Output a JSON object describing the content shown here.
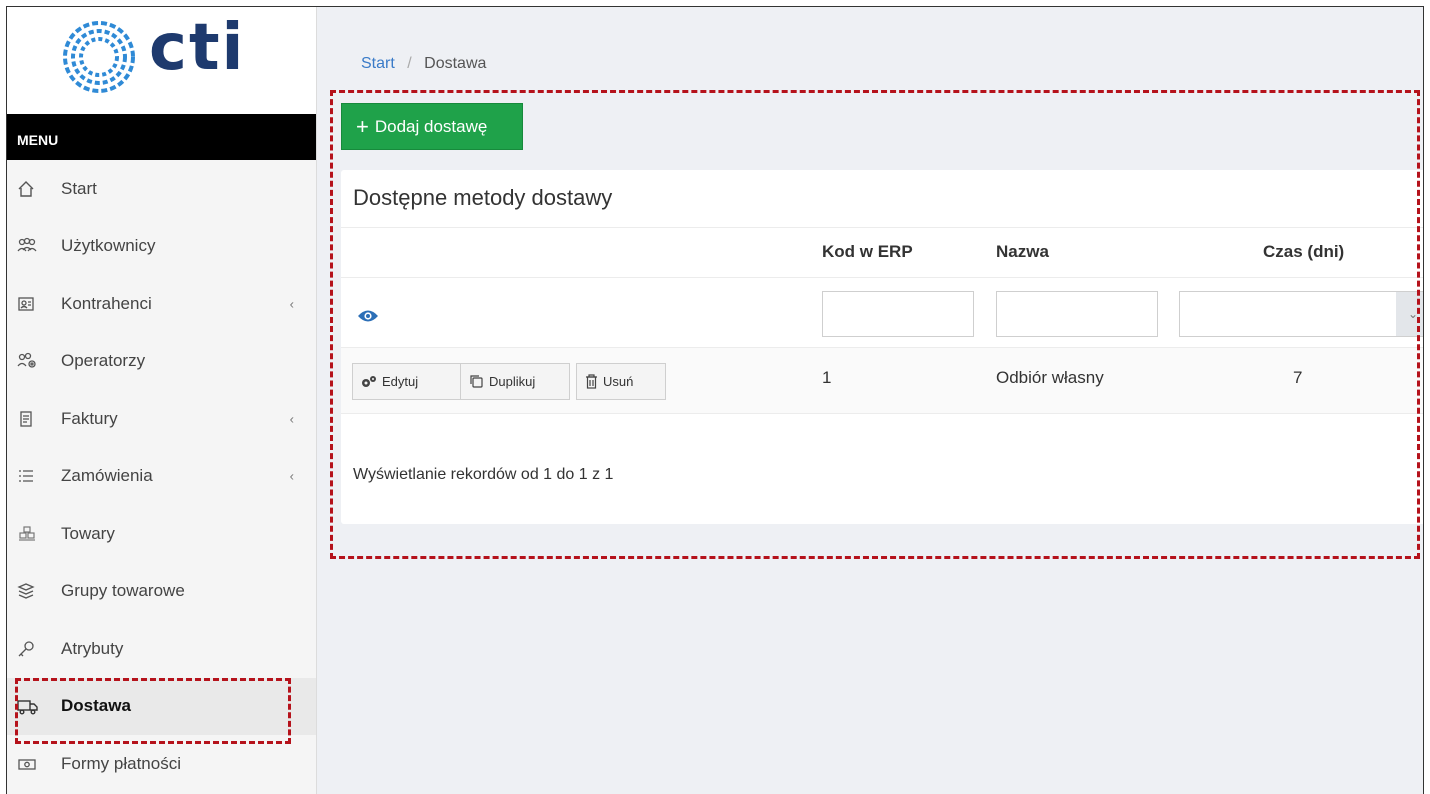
{
  "brand": {
    "logo_text": "cti"
  },
  "sidebar": {
    "menu_label": "MENU",
    "items": [
      {
        "label": "Start",
        "icon": "home-icon"
      },
      {
        "label": "Użytkownicy",
        "icon": "users-icon"
      },
      {
        "label": "Kontrahenci",
        "icon": "contact-card-icon",
        "chevron": "‹"
      },
      {
        "label": "Operatorzy",
        "icon": "operators-icon"
      },
      {
        "label": "Faktury",
        "icon": "invoice-icon",
        "chevron": "‹"
      },
      {
        "label": "Zamówienia",
        "icon": "list-icon",
        "chevron": "‹"
      },
      {
        "label": "Towary",
        "icon": "boxes-icon"
      },
      {
        "label": "Grupy towarowe",
        "icon": "layers-icon"
      },
      {
        "label": "Atrybuty",
        "icon": "key-icon"
      },
      {
        "label": "Dostawa",
        "icon": "truck-icon",
        "active": true
      },
      {
        "label": "Formy płatności",
        "icon": "money-icon"
      }
    ]
  },
  "breadcrumb": {
    "home": "Start",
    "separator": "/",
    "current": "Dostawa"
  },
  "toolbar": {
    "add_label": "Dodaj dostawę",
    "add_icon": "+"
  },
  "panel": {
    "title": "Dostępne metody dostawy",
    "columns": {
      "code": "Kod w ERP",
      "name": "Nazwa",
      "time": "Czas (dni)"
    },
    "filters": {
      "code_value": "",
      "name_value": "",
      "time_value": ""
    },
    "actions": {
      "edit": "Edytuj",
      "duplicate": "Duplikuj",
      "delete": "Usuń"
    },
    "rows": [
      {
        "code": "1",
        "name": "Odbiór własny",
        "time": "7"
      }
    ],
    "info": "Wyświetlanie rekordów od 1 do 1 z 1"
  },
  "colors": {
    "primary_button": "#1fa24a",
    "highlight": "#b5121b",
    "link": "#3a7bc8",
    "logo": "#1e3a6e"
  }
}
